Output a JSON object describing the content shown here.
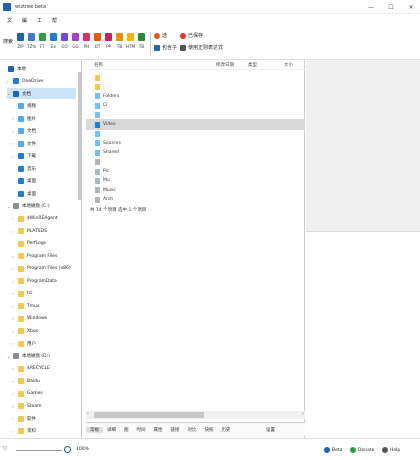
{
  "window": {
    "title": "wiztree beta",
    "controls": {
      "minimize": "—",
      "maximize": "☐",
      "close": "✕"
    }
  },
  "menu": {
    "items": [
      "文",
      "編",
      "工",
      "帮"
    ]
  },
  "toolbar": {
    "search_label": "搜索",
    "filetypes": [
      {
        "label": "ZIP",
        "color": "#1e62b3"
      },
      {
        "label": "7Z%",
        "color": "#3a7bd5"
      },
      {
        "label": "FT",
        "color": "#2f9e44"
      },
      {
        "label": "Ex",
        "color": "#1c7ed6"
      },
      {
        "label": "GO",
        "color": "#7048e8"
      },
      {
        "label": "GG",
        "color": "#ae3ec9"
      },
      {
        "label": "PH",
        "color": "#d6336c"
      },
      {
        "label": "DT",
        "color": "#e8590c"
      },
      {
        "label": "PP",
        "color": "#c2255c"
      },
      {
        "label": "TB",
        "color": "#f08c00"
      },
      {
        "label": "HTM",
        "color": "#fab005"
      },
      {
        "label": "TB",
        "color": "#2b8a3e"
      }
    ],
    "options": [
      {
        "label": "选",
        "color": "#e8590c"
      },
      {
        "label": "已保存",
        "color": "#e03131"
      },
      {
        "label": "包含子",
        "color": "#1e62b3"
      },
      {
        "label": "使用正则表达式",
        "color": "#555555"
      }
    ]
  },
  "tree": {
    "nodes": [
      {
        "label": "本地",
        "color": "#1e62b3",
        "exp": "",
        "indent": 0
      },
      {
        "label": "OneDrive",
        "color": "#1c7ed6",
        "exp": "›",
        "indent": 1
      },
      {
        "label": "文档",
        "color": "#1e62b3",
        "exp": "⌄",
        "indent": 1,
        "selected": true
      },
      {
        "label": "视频",
        "color": "#4dabf7",
        "exp": "",
        "indent": 2
      },
      {
        "label": "图片",
        "color": "#4dabf7",
        "exp": "›",
        "indent": 2
      },
      {
        "label": "文档",
        "color": "#4dabf7",
        "exp": "›",
        "indent": 2
      },
      {
        "label": "文件",
        "color": "#4dabf7",
        "exp": "›",
        "indent": 2
      },
      {
        "label": "下载",
        "color": "#1c7ed6",
        "exp": "›",
        "indent": 2
      },
      {
        "label": "音乐",
        "color": "#1c7ed6",
        "exp": "",
        "indent": 2
      },
      {
        "label": "桌面",
        "color": "#1c7ed6",
        "exp": "",
        "indent": 2
      },
      {
        "label": "桌面",
        "color": "#1c7ed6",
        "exp": "",
        "indent": 2
      },
      {
        "label": "本地磁盘 (C:)",
        "color": "#868e96",
        "exp": "⌄",
        "indent": 1
      },
      {
        "label": "$WinREAgent",
        "color": "#f2c94c",
        "exp": "›",
        "indent": 2
      },
      {
        "label": "PLATSDS",
        "color": "#f2c94c",
        "exp": "›",
        "indent": 2
      },
      {
        "label": "PerfLogs",
        "color": "#f2c94c",
        "exp": "",
        "indent": 2
      },
      {
        "label": "Program Files",
        "color": "#f2c94c",
        "exp": "›",
        "indent": 2
      },
      {
        "label": "Program Files (x86)",
        "color": "#f2c94c",
        "exp": "›",
        "indent": 2
      },
      {
        "label": "ProgramData",
        "color": "#f2c94c",
        "exp": "›",
        "indent": 2
      },
      {
        "label": "tcl",
        "color": "#f2c94c",
        "exp": "›",
        "indent": 2
      },
      {
        "label": "Tmux",
        "color": "#f2c94c",
        "exp": "›",
        "indent": 2
      },
      {
        "label": "Windows",
        "color": "#f2c94c",
        "exp": "›",
        "indent": 2
      },
      {
        "label": "Xbox",
        "color": "#f2c94c",
        "exp": "›",
        "indent": 2
      },
      {
        "label": "用户",
        "color": "#f2c94c",
        "exp": "›",
        "indent": 2
      },
      {
        "label": "本地磁盘 (D:)",
        "color": "#868e96",
        "exp": "⌄",
        "indent": 1
      },
      {
        "label": "$RECYCLE",
        "color": "#f2c94c",
        "exp": "›",
        "indent": 2
      },
      {
        "label": "Baidu",
        "color": "#f2c94c",
        "exp": "›",
        "indent": 2
      },
      {
        "label": "Games",
        "color": "#f2c94c",
        "exp": "›",
        "indent": 2
      },
      {
        "label": "Steam",
        "color": "#f2c94c",
        "exp": "›",
        "indent": 2
      },
      {
        "label": "软件",
        "color": "#f2c94c",
        "exp": "›",
        "indent": 2
      },
      {
        "label": "资料",
        "color": "#f2c94c",
        "exp": "›",
        "indent": 2
      }
    ]
  },
  "list": {
    "headers": {
      "name": "名称",
      "date": "修改日期",
      "type": "类型",
      "size": "大小"
    },
    "rows": [
      {
        "name": "",
        "color": "#f2c94c"
      },
      {
        "name": "..",
        "color": "#f2c94c"
      },
      {
        "name": "Folders",
        "color": "#74c0fc"
      },
      {
        "name": "Cl",
        "color": "#74c0fc"
      },
      {
        "name": "",
        "color": "#74c0fc"
      },
      {
        "name": "Video",
        "color": "#1c7ed6",
        "selected": true
      },
      {
        "name": "",
        "color": "#74c0fc"
      },
      {
        "name": "Sources",
        "color": "#74c0fc"
      },
      {
        "name": "Shared",
        "color": "#74c0fc"
      },
      {
        "name": "",
        "color": "#adb5bd"
      },
      {
        "name": "Pic",
        "color": "#adb5bd"
      },
      {
        "name": "Mu",
        "color": "#adb5bd"
      },
      {
        "name": "Music",
        "color": "#adb5bd"
      },
      {
        "name": "Arch",
        "color": "#adb5bd"
      }
    ],
    "status": "共 14 个项目 选中 1 个项目"
  },
  "bottom_tabs": {
    "items": [
      "常规",
      "详细",
      "图",
      "时间",
      "属性",
      "链接",
      "对比",
      "快照",
      "历史"
    ],
    "right": "设置"
  },
  "statusbar": {
    "zoom": "100%",
    "items": [
      {
        "label": "Beta",
        "color": "#1e62b3"
      },
      {
        "label": "Donate",
        "color": "#2f9e44"
      },
      {
        "label": "Help",
        "color": "#555555"
      }
    ]
  }
}
